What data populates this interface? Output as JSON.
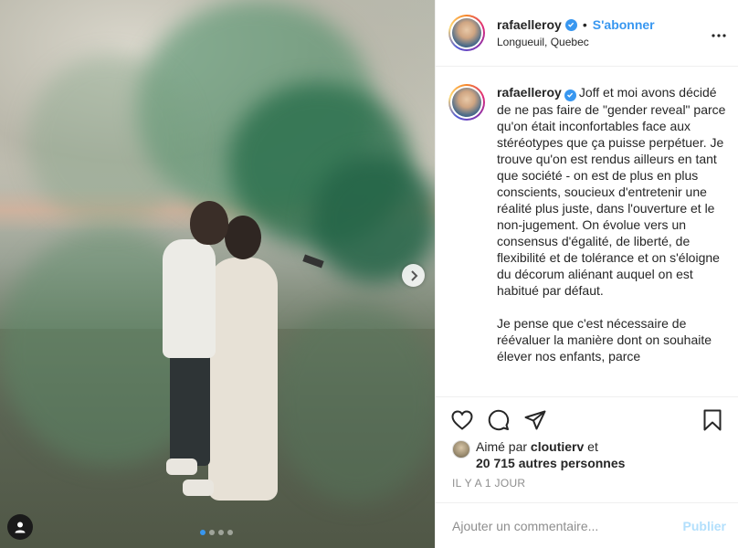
{
  "post": {
    "username": "rafaelleroy",
    "follow_label": "S'abonner",
    "separator": "•",
    "location": "Longueuil, Quebec",
    "caption_p1": "Joff et moi avons décidé de ne pas faire de \"gender reveal\" parce qu'on était inconfortables face aux stéréotypes que ça puisse perpétuer. Je trouve qu'on est rendus ailleurs en tant que société - on est de plus en plus conscients, soucieux d'entretenir une réalité plus juste, dans l'ouverture et le non-jugement. On évolue vers un consensus d'égalité, de liberté, de flexibilité et de tolérance et on s'éloigne du décorum aliénant auquel on est habitué par défaut.",
    "caption_p2": "Je pense que c'est nécessaire de réévaluer la manière dont on souhaite élever nos enfants, parce"
  },
  "likes": {
    "prefix": "Aimé par",
    "liker": "cloutierv",
    "and": "et",
    "others": "20 715 autres personnes"
  },
  "timestamp": "IL Y A 1 JOUR",
  "comment": {
    "placeholder": "Ajouter un commentaire...",
    "publish_label": "Publier"
  },
  "carousel": {
    "slides": 4,
    "active_index": 0
  },
  "colors": {
    "accent": "#3897f0",
    "publish_disabled": "#b2dffc",
    "muted": "#8e8e8e",
    "text": "#262626"
  },
  "icons": [
    "next-arrow-icon",
    "user-tag-icon",
    "verified-icon",
    "more-options-icon",
    "heart-icon",
    "comment-icon",
    "share-icon",
    "bookmark-icon"
  ]
}
